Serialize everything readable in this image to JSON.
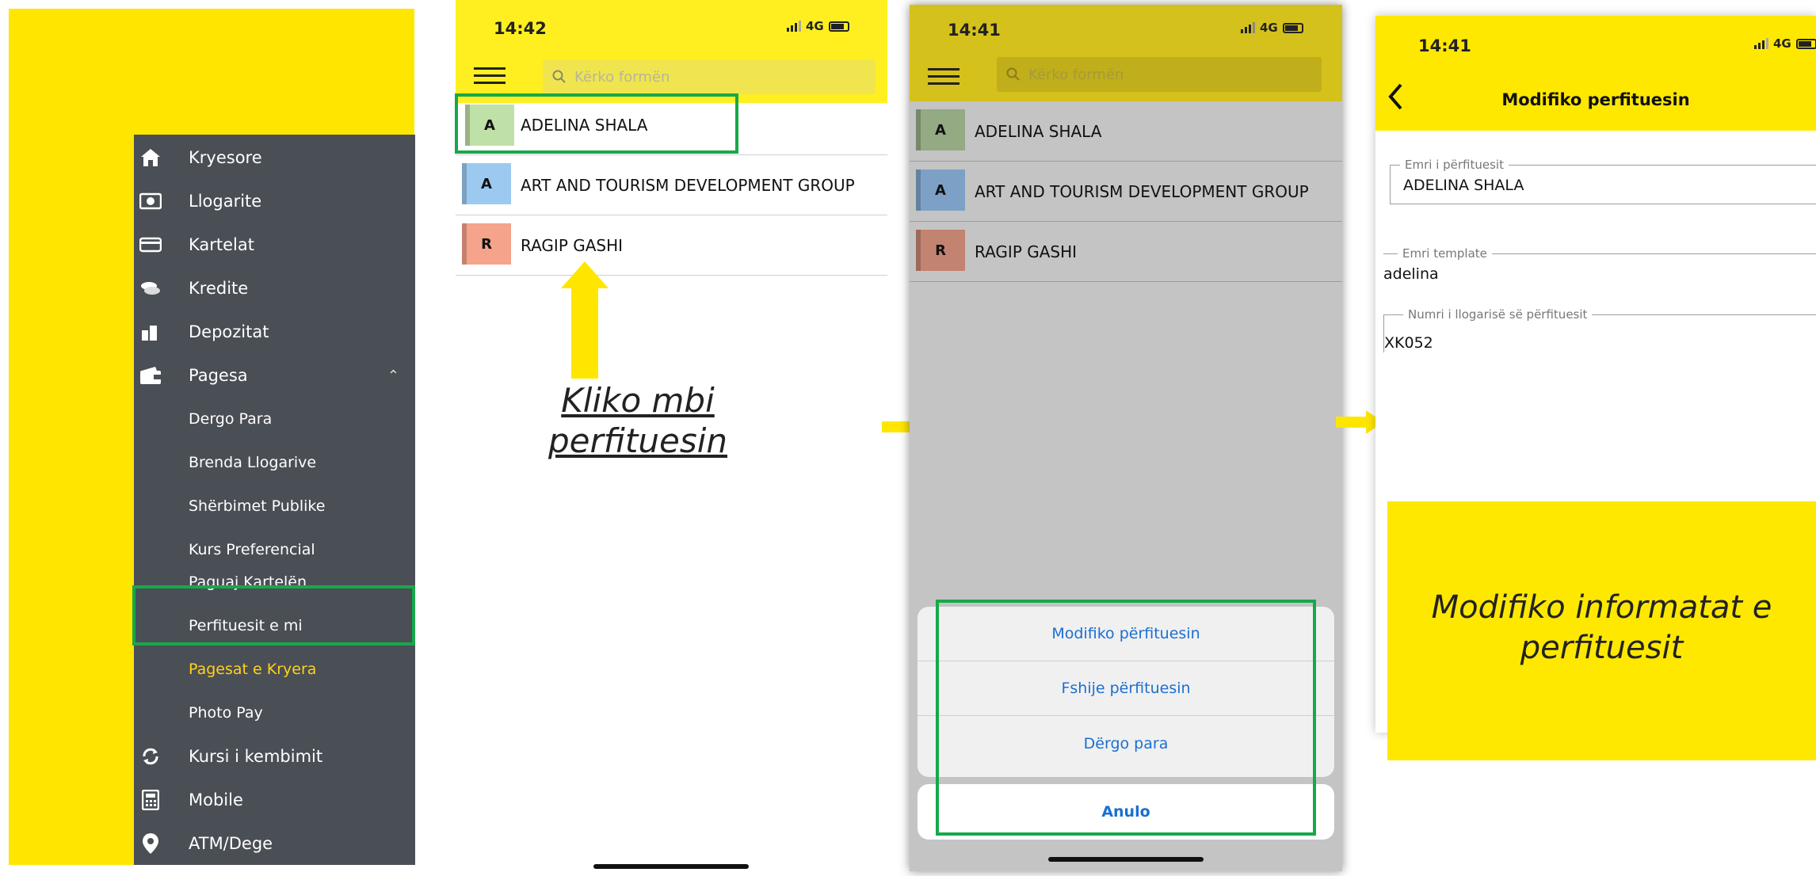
{
  "menu": {
    "items": [
      {
        "label": "Kryesore",
        "icon": "home-icon"
      },
      {
        "label": "Llogarite",
        "icon": "accounts-icon"
      },
      {
        "label": "Kartelat",
        "icon": "card-icon"
      },
      {
        "label": "Kredite",
        "icon": "loan-icon"
      },
      {
        "label": "Depozitat",
        "icon": "deposit-icon"
      },
      {
        "label": "Pagesa",
        "icon": "wallet-icon"
      },
      {
        "label": "Dergo Para"
      },
      {
        "label": "Brenda Llogarive"
      },
      {
        "label": "Shërbimet Publike"
      },
      {
        "label": "Kurs Preferencial"
      },
      {
        "label": "Paguaj Kartelën"
      },
      {
        "label": "Perfituesit e mi"
      },
      {
        "label": "Pagesat e Kryera"
      },
      {
        "label": "Photo Pay"
      },
      {
        "label": "Kursi i kembimit",
        "icon": "exchange-icon"
      },
      {
        "label": "Mobile",
        "icon": "calculator-icon"
      },
      {
        "label": "ATM/Dege",
        "icon": "location-pin-icon"
      }
    ]
  },
  "phone2": {
    "time": "14:42",
    "network": "4G",
    "search_placeholder": "Kërko formën",
    "rows": [
      {
        "initial": "A",
        "name": "ADELINA SHALA",
        "color": "#bfe0a6"
      },
      {
        "initial": "A",
        "name": "ART AND TOURISM DEVELOPMENT GROUP",
        "color": "#9cc9f0"
      },
      {
        "initial": "R",
        "name": "RAGIP GASHI",
        "color": "#f5a38a"
      }
    ],
    "caption_line1": "Kliko mbi",
    "caption_line2": "perfituesin"
  },
  "phone3": {
    "time": "14:41",
    "network": "4G",
    "search_placeholder": "Kërko formën",
    "rows": [
      {
        "initial": "A",
        "name": "ADELINA SHALA",
        "color": "#93aa83"
      },
      {
        "initial": "A",
        "name": "ART AND TOURISM DEVELOPMENT GROUP",
        "color": "#7da1c6"
      },
      {
        "initial": "R",
        "name": "RAGIP GASHI",
        "color": "#c38371"
      }
    ],
    "actions": [
      "Modifiko përfituesin",
      "Fshije përfituesin",
      "Dërgo para"
    ],
    "cancel": "Anulo"
  },
  "phone4": {
    "time": "14:41",
    "network": "4G",
    "title": "Modifiko perfituesin",
    "fields": [
      {
        "label": "Emri i përfituesit",
        "value": "ADELINA SHALA"
      },
      {
        "label": "Emri template",
        "value": "adelina"
      },
      {
        "label": "Numri i llogarisë së përfituesit",
        "value": "XK052"
      }
    ],
    "caption": "Modifiko informatat e perfituesit"
  },
  "colors": {
    "accent_yellow": "#ffe600",
    "highlight_green": "#17a84a",
    "link_blue": "#1a6fd2",
    "menu_bg": "#4a4e55"
  }
}
